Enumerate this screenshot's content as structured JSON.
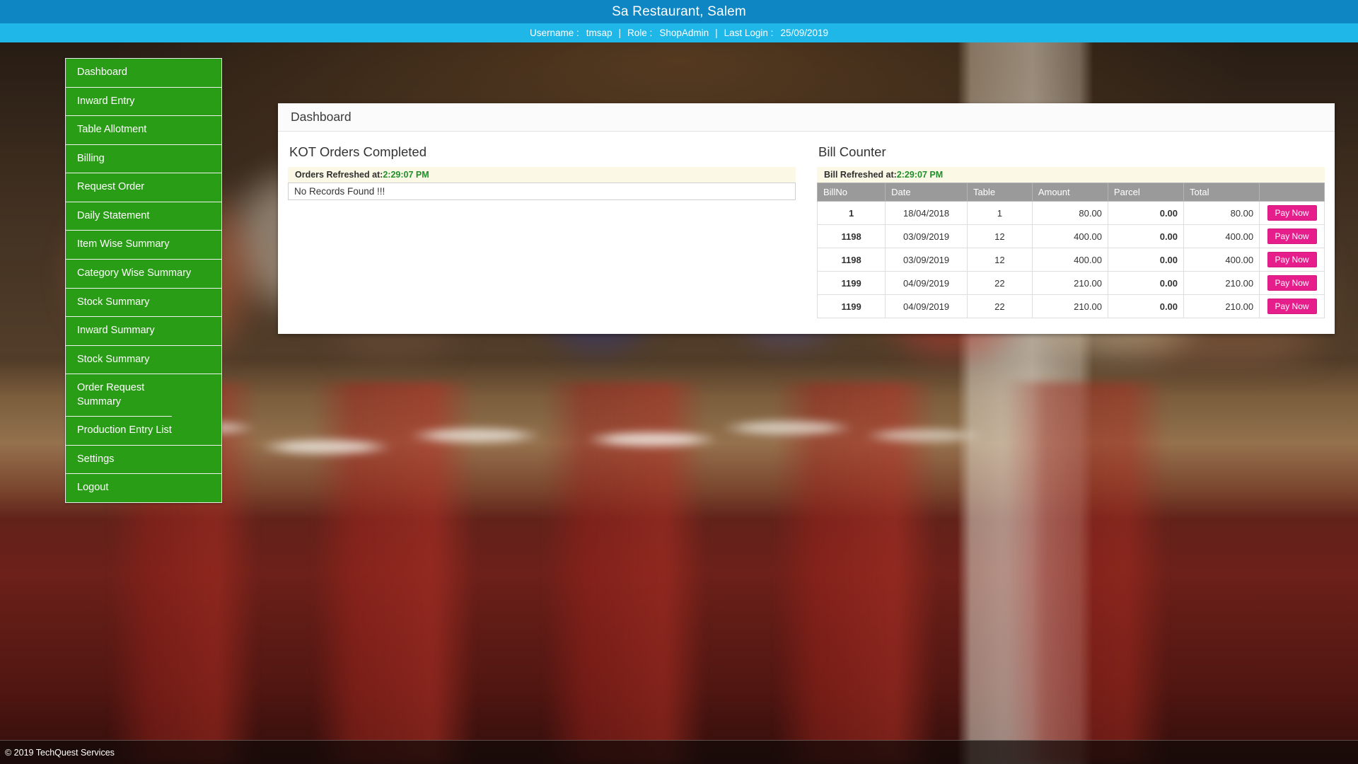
{
  "header": {
    "title": "Sa Restaurant, Salem",
    "username_label": "Username :",
    "username_value": "tmsap",
    "role_label": "Role :",
    "role_value": "ShopAdmin",
    "last_login_label": "Last Login :",
    "last_login_value": "25/09/2019",
    "separator": "|"
  },
  "sidebar": {
    "items": [
      {
        "label": "Dashboard"
      },
      {
        "label": "Inward Entry"
      },
      {
        "label": "Table Allotment"
      },
      {
        "label": "Billing"
      },
      {
        "label": "Request Order"
      },
      {
        "label": "Daily Statement"
      },
      {
        "label": "Item Wise Summary"
      },
      {
        "label": "Category Wise Summary"
      },
      {
        "label": "Stock Summary"
      },
      {
        "label": "Inward Summary"
      },
      {
        "label": "Stock Summary"
      },
      {
        "label": "Order Request Summary"
      },
      {
        "label": "Production Entry List"
      },
      {
        "label": "Settings"
      },
      {
        "label": "Logout"
      }
    ]
  },
  "content": {
    "page_title": "Dashboard",
    "kot_panel": {
      "title": "KOT Orders Completed",
      "refresh_label": "Orders Refreshed at:",
      "refresh_time": "2:29:07 PM",
      "empty_message": "No Records Found !!!"
    },
    "bill_panel": {
      "title": "Bill Counter",
      "refresh_label": "Bill Refreshed at:",
      "refresh_time": "2:29:07 PM",
      "columns": [
        "BillNo",
        "Date",
        "Table",
        "Amount",
        "Parcel",
        "Total",
        ""
      ],
      "rows": [
        {
          "billno": "1",
          "date": "18/04/2018",
          "table": "1",
          "amount": "80.00",
          "parcel": "0.00",
          "total": "80.00",
          "action": "Pay Now"
        },
        {
          "billno": "1198",
          "date": "03/09/2019",
          "table": "12",
          "amount": "400.00",
          "parcel": "0.00",
          "total": "400.00",
          "action": "Pay Now"
        },
        {
          "billno": "1198",
          "date": "03/09/2019",
          "table": "12",
          "amount": "400.00",
          "parcel": "0.00",
          "total": "400.00",
          "action": "Pay Now"
        },
        {
          "billno": "1199",
          "date": "04/09/2019",
          "table": "22",
          "amount": "210.00",
          "parcel": "0.00",
          "total": "210.00",
          "action": "Pay Now"
        },
        {
          "billno": "1199",
          "date": "04/09/2019",
          "table": "22",
          "amount": "210.00",
          "parcel": "0.00",
          "total": "210.00",
          "action": "Pay Now"
        }
      ]
    }
  },
  "footer": {
    "copyright": "© 2019 TechQuest Services"
  },
  "colors": {
    "title_bar": "#0e86c4",
    "user_bar": "#1fb6e8",
    "sidebar_green": "#2a9d16",
    "accent_green": "#1f8f2a",
    "billno_purple": "#8d23d6",
    "pay_pink": "#e61e8c",
    "table_header_gray": "#9a9a9a"
  }
}
